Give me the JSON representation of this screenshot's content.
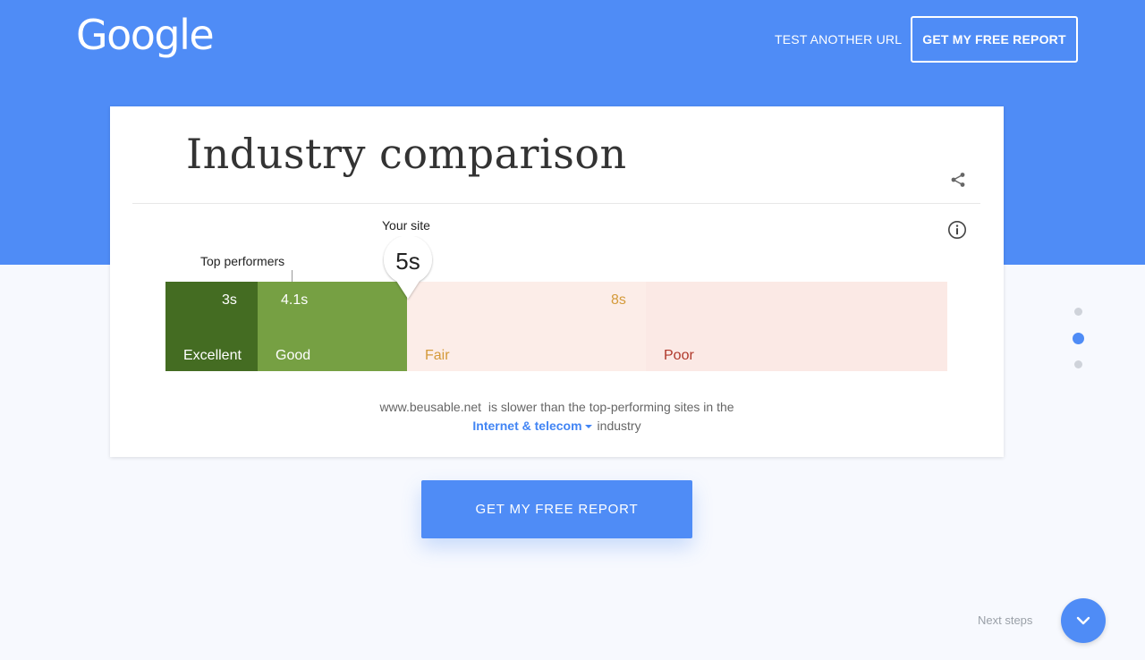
{
  "header": {
    "logo": "Google",
    "test_another_url": "TEST ANOTHER URL",
    "get_report": "GET MY FREE REPORT"
  },
  "card": {
    "title": "Industry comparison",
    "your_site_label": "Your site",
    "your_site_value": "5s",
    "top_performers_label": "Top performers",
    "segments": [
      {
        "label": "Excellent",
        "threshold": "3s",
        "color": "#446c22"
      },
      {
        "label": "Good",
        "threshold": "4.1s",
        "color": "#76a043"
      },
      {
        "label": "Fair",
        "threshold": "8s",
        "color": "#fcede8",
        "text_color": "#d49a3a"
      },
      {
        "label": "Poor",
        "threshold": "",
        "color": "#fbe9e5",
        "text_color": "#b0382a"
      }
    ],
    "summary": {
      "site": "www.beusable.net",
      "text_1": "is slower than the top-performing sites in the",
      "industry_selected": "Internet & telecom",
      "text_2": "industry"
    }
  },
  "cta": {
    "label": "GET MY FREE REPORT"
  },
  "pager": {
    "total": 3,
    "active_index": 1
  },
  "next_steps": {
    "label": "Next steps"
  },
  "colors": {
    "hero": "#4f8cf6",
    "accent": "#4285f4",
    "background": "#f7f9fe"
  },
  "icons": [
    "share-icon",
    "info-icon",
    "chevron-down-icon",
    "caret-down-icon"
  ]
}
